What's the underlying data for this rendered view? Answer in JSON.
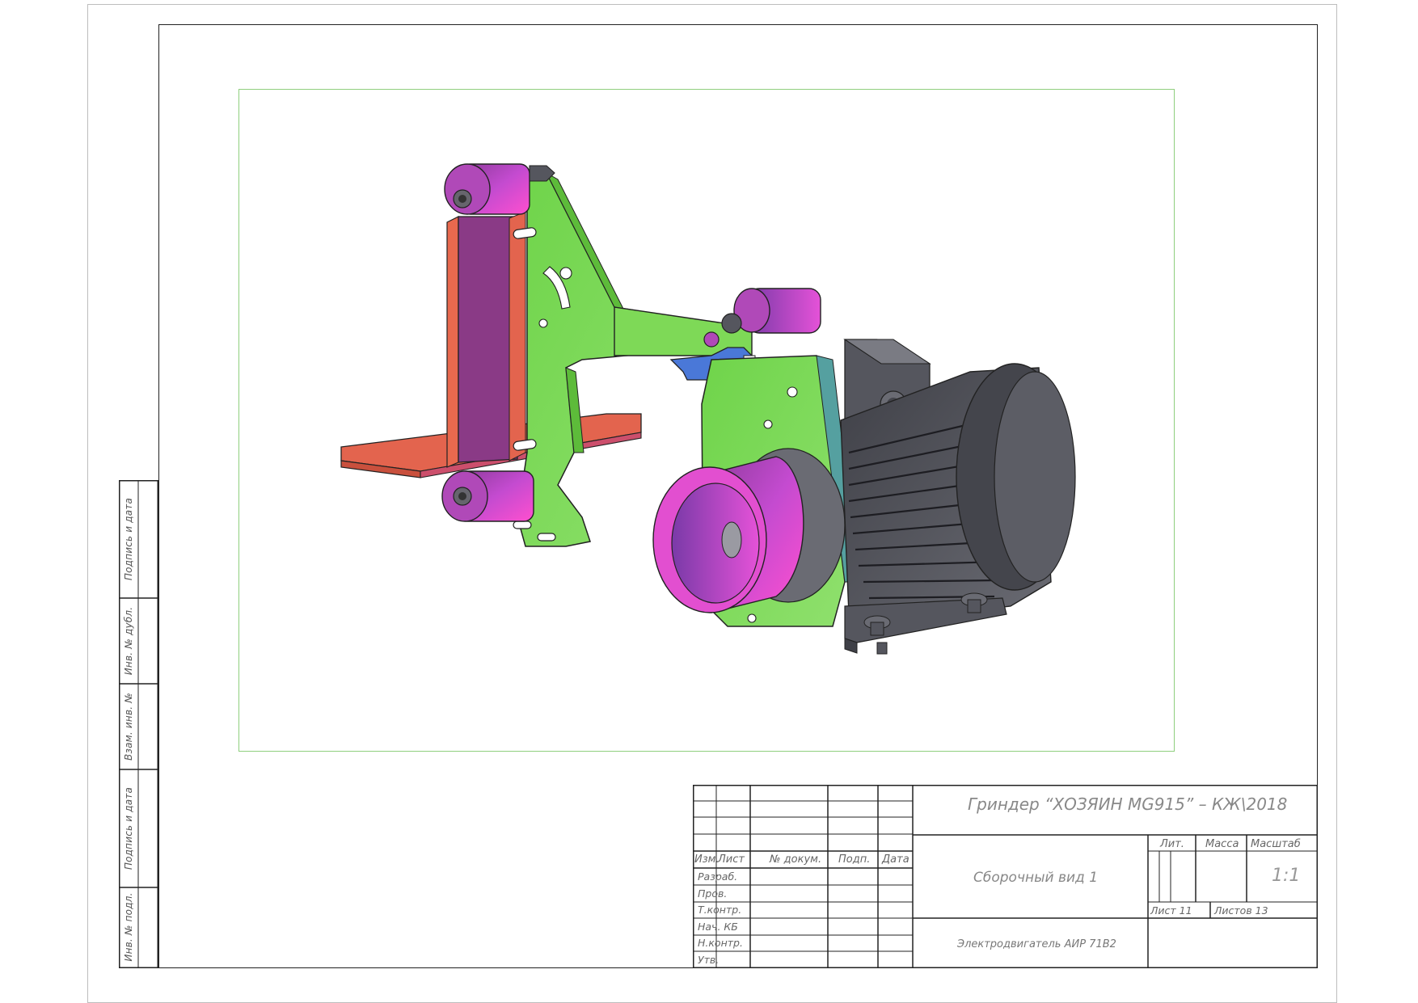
{
  "sheet": {
    "side_stamp": {
      "fields": [
        "Инв. № подл.",
        "Подпись и дата",
        "Взам. инв. №",
        "Инв. № дубл.",
        "Подпись и дата"
      ]
    }
  },
  "drawing": {
    "parts": [
      {
        "name": "drive-wheel",
        "color": "#d94fd6"
      },
      {
        "name": "electric-motor",
        "color": "#55565e"
      },
      {
        "name": "frame-plate",
        "color": "#7ed957"
      },
      {
        "name": "belt",
        "color": "#8a3a86"
      },
      {
        "name": "work-table",
        "color": "#e8694e"
      },
      {
        "name": "tension-lever",
        "color": "#4a78d8"
      }
    ]
  },
  "title_block": {
    "designation": "Гриндер “ХОЗЯИН MG915” – КЖ\\2018",
    "document_name": "Сборочный вид 1",
    "component": "Электродвигатель АИР 71В2",
    "columns": {
      "izm": "Изм.",
      "list": "Лист",
      "doc_no": "№ докум.",
      "sign": "Подп.",
      "date": "Дата"
    },
    "roles": [
      "Разраб.",
      "Пров.",
      "Т.контр.",
      "Нач. КБ",
      "Н.контр.",
      "Утв."
    ],
    "lit_label": "Лит.",
    "mass_label": "Масса",
    "scale_label": "Масштаб",
    "scale_value": "1:1",
    "sheet_label": "Лист 11",
    "sheets_label": "Листов 13"
  }
}
